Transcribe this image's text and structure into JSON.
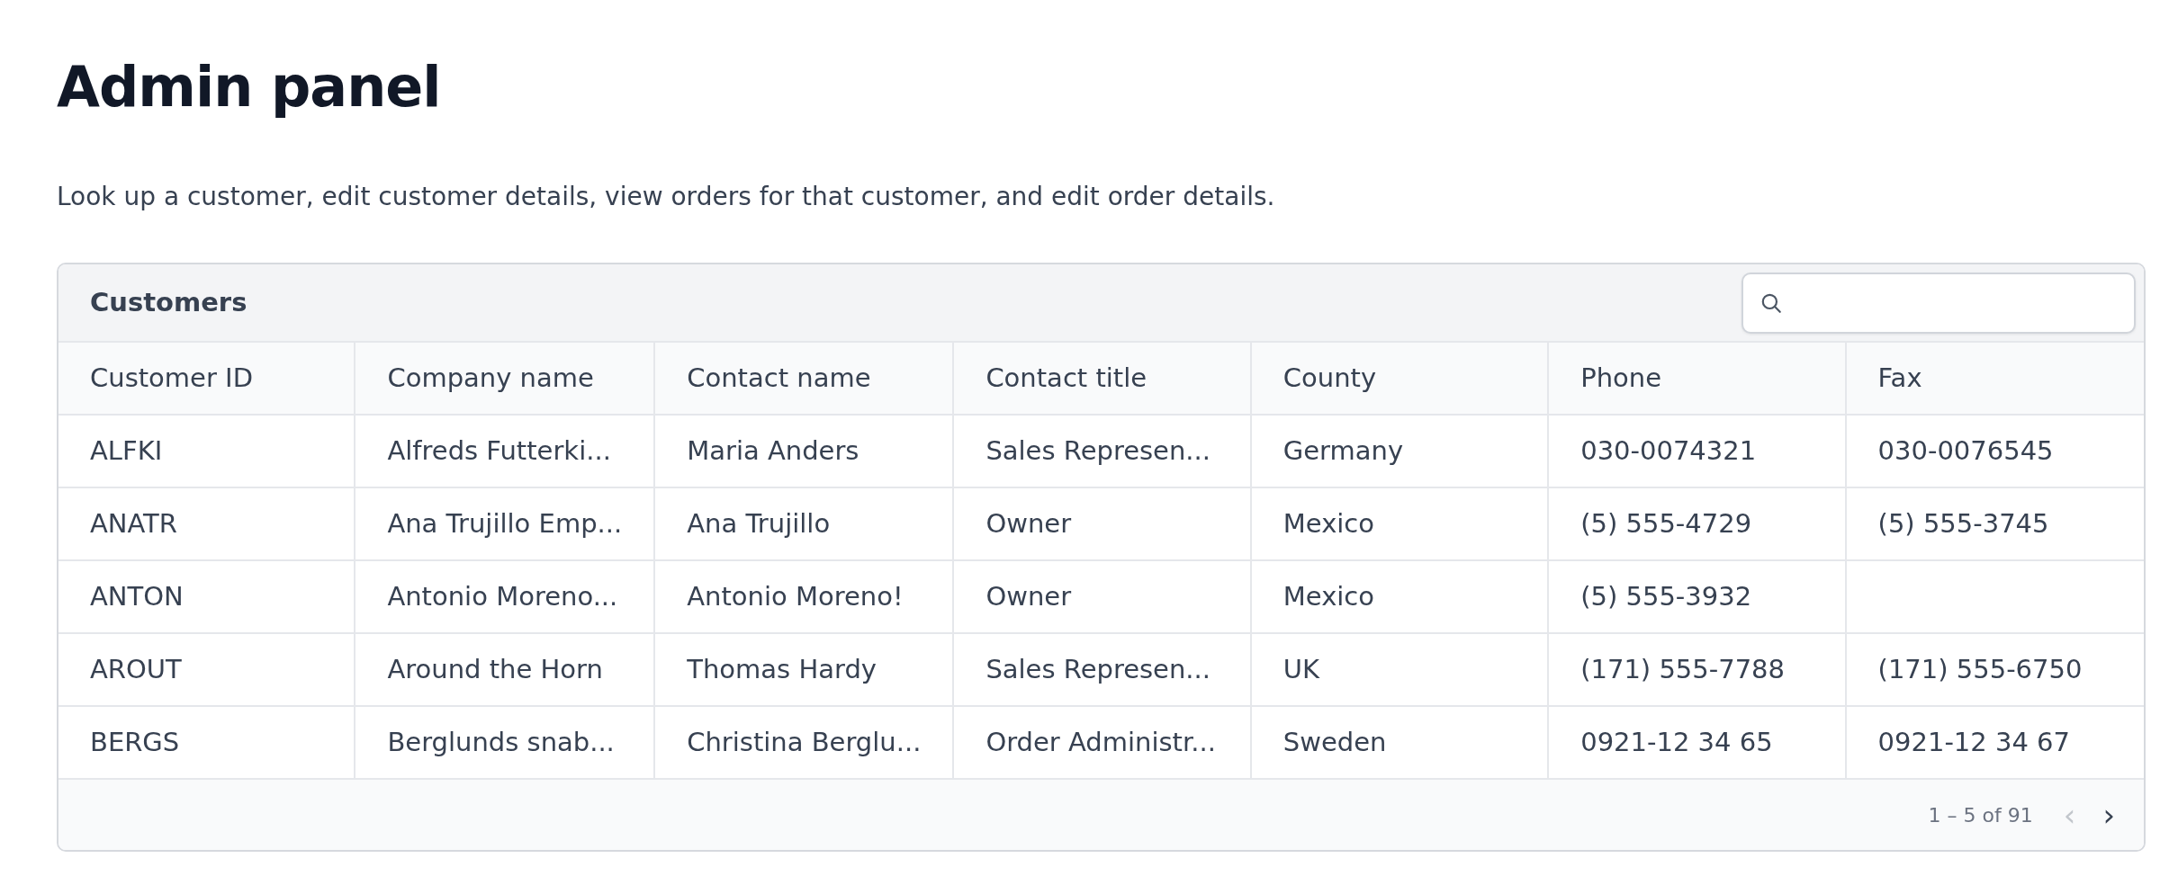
{
  "page": {
    "title": "Admin panel",
    "description": "Look up a customer, edit customer details, view orders for that customer, and edit order details."
  },
  "table": {
    "title": "Customers",
    "columns": [
      "Customer ID",
      "Company name",
      "Contact name",
      "Contact title",
      "County",
      "Phone",
      "Fax"
    ],
    "rows": [
      [
        "ALFKI",
        "Alfreds Futterki...",
        "Maria Anders",
        "Sales Represen...",
        "Germany",
        "030-0074321",
        "030-0076545"
      ],
      [
        "ANATR",
        "Ana Trujillo Emp...",
        "Ana Trujillo",
        "Owner",
        "Mexico",
        "(5) 555-4729",
        "(5) 555-3745"
      ],
      [
        "ANTON",
        "Antonio Moreno...",
        "Antonio Moreno!",
        "Owner",
        "Mexico",
        "(5) 555-3932",
        null
      ],
      [
        "AROUT",
        "Around the Horn",
        "Thomas Hardy",
        "Sales Represen...",
        "UK",
        "(171) 555-7788",
        "(171) 555-6750"
      ],
      [
        "BERGS",
        "Berglunds snab...",
        "Christina Berglu...",
        "Order Administr...",
        "Sweden",
        "0921-12 34 65",
        "0921-12 34 67"
      ]
    ],
    "pagination": {
      "range": "1 – 5 of 91",
      "prev": {
        "label": "‹",
        "disabled": true
      },
      "next": {
        "label": "›",
        "disabled": false
      }
    }
  }
}
